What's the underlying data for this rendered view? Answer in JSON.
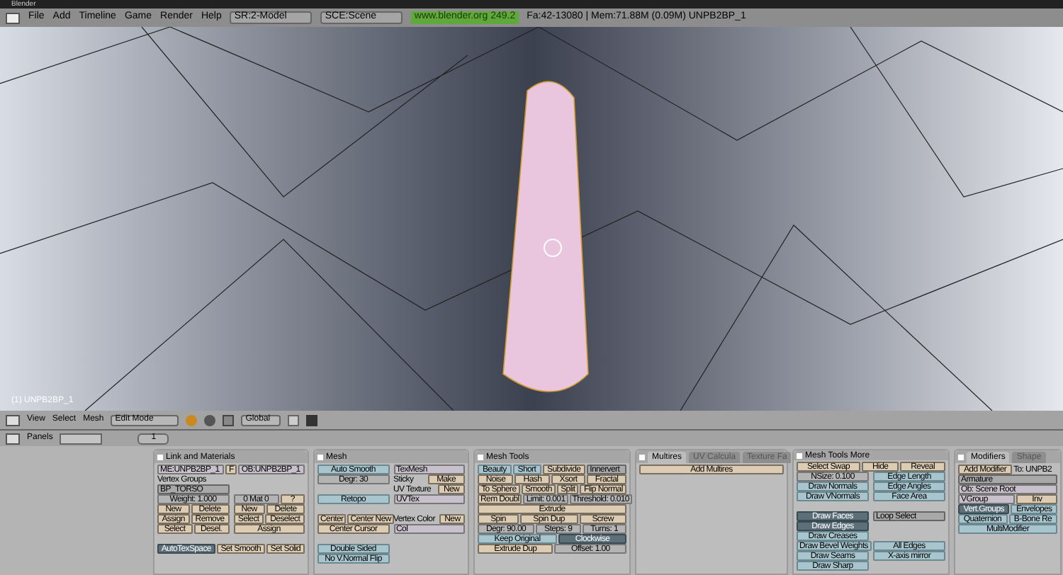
{
  "window": {
    "title": "Blender"
  },
  "menu_bar": {
    "menus": [
      "File",
      "Add",
      "Timeline",
      "Game",
      "Render",
      "Help"
    ],
    "screen": "SR:2-Model",
    "scene": "SCE:Scene",
    "version": "www.blender.org 249.2",
    "stats": "Fa:42-13080 | Mem:71.88M (0.09M) UNPB2BP_1"
  },
  "viewport": {
    "object_label": "(1) UNPB2BP_1"
  },
  "viewport_header": {
    "menus": [
      "View",
      "Select",
      "Mesh"
    ],
    "mode": "Edit Mode",
    "orientation": "Global"
  },
  "buttons_header": {
    "label": "Panels",
    "frame": "1"
  },
  "panels": [
    {
      "title": "Link and Materials",
      "sections": [
        {
          "kind": "rows",
          "rows": [
            [
              {
                "kind": "text",
                "label": "ME:UNPB2BP_1"
              },
              {
                "kind": "button",
                "label": "F"
              },
              {
                "kind": "text",
                "label": "OB:UNPB2BP_1"
              }
            ]
          ]
        },
        {
          "kind": "columns",
          "columns": [
            [
              [
                {
                  "kind": "label",
                  "label": "Vertex Groups"
                }
              ],
              [
                {
                  "kind": "menu",
                  "label": "BP_TORSO"
                }
              ],
              [
                {
                  "kind": "field",
                  "label": "Weight: 1.000"
                }
              ],
              [
                {
                  "kind": "button",
                  "label": "New"
                },
                {
                  "kind": "button",
                  "label": "Delete"
                }
              ],
              [
                {
                  "kind": "button",
                  "label": "Assign"
                },
                {
                  "kind": "button",
                  "label": "Remove"
                }
              ],
              [
                {
                  "kind": "button",
                  "label": "Select"
                },
                {
                  "kind": "button",
                  "label": "Desel."
                }
              ]
            ],
            [
              [
                {
                  "kind": "gap"
                }
              ],
              [
                {
                  "kind": "gap"
                }
              ],
              [
                {
                  "kind": "field",
                  "label": "0 Mat 0"
                },
                {
                  "kind": "button",
                  "label": "?"
                }
              ],
              [
                {
                  "kind": "button",
                  "label": "New"
                },
                {
                  "kind": "button",
                  "label": "Delete"
                }
              ],
              [
                {
                  "kind": "button",
                  "label": "Select"
                },
                {
                  "kind": "button",
                  "label": "Deselect"
                }
              ],
              [
                {
                  "kind": "button",
                  "label": "Assign"
                }
              ]
            ]
          ]
        },
        {
          "kind": "rows",
          "rows": [
            [
              {
                "kind": "gap"
              }
            ],
            [
              {
                "kind": "toggle",
                "label": "AutoTexSpace",
                "selected": true
              },
              {
                "kind": "button",
                "label": "Set Smooth"
              },
              {
                "kind": "button",
                "label": "Set Solid"
              }
            ]
          ]
        }
      ]
    },
    {
      "title": "Mesh",
      "sections": [
        {
          "kind": "columns",
          "columns": [
            [
              [
                {
                  "kind": "toggle",
                  "label": "Auto Smooth",
                  "selected": false
                }
              ],
              [
                {
                  "kind": "field",
                  "label": "Degr: 30"
                }
              ],
              [
                {
                  "kind": "gap"
                }
              ],
              [
                {
                  "kind": "toggle",
                  "label": "Retopo",
                  "selected": false
                }
              ],
              [
                {
                  "kind": "gap"
                }
              ],
              [
                {
                  "kind": "button",
                  "label": "Center"
                },
                {
                  "kind": "button",
                  "label": "Center New"
                }
              ],
              [
                {
                  "kind": "button",
                  "label": "Center Cursor"
                }
              ],
              [
                {
                  "kind": "gap"
                }
              ],
              [
                {
                  "kind": "toggle",
                  "label": "Double Sided",
                  "selected": false
                }
              ],
              [
                {
                  "kind": "toggle",
                  "label": "No V.Normal Flip",
                  "selected": false
                }
              ]
            ],
            [
              [
                {
                  "kind": "text",
                  "label": "TexMesh"
                }
              ],
              [
                {
                  "kind": "label",
                  "label": "Sticky"
                },
                {
                  "kind": "button",
                  "label": "Make"
                }
              ],
              [
                {
                  "kind": "label",
                  "label": "UV Texture"
                },
                {
                  "kind": "button",
                  "label": "New"
                }
              ],
              [
                {
                  "kind": "text",
                  "label": "UVTex"
                }
              ],
              [
                {
                  "kind": "gap"
                }
              ],
              [
                {
                  "kind": "label",
                  "label": "Vertex Color"
                },
                {
                  "kind": "button",
                  "label": "New"
                }
              ],
              [
                {
                  "kind": "text",
                  "label": "Col"
                }
              ]
            ]
          ]
        }
      ]
    },
    {
      "title": "Mesh Tools",
      "sections": [
        {
          "kind": "rows",
          "rows": [
            [
              {
                "kind": "toggle",
                "label": "Beauty",
                "selected": false
              },
              {
                "kind": "toggle",
                "label": "Short",
                "selected": false
              },
              {
                "kind": "button",
                "label": "Subdivide"
              },
              {
                "kind": "menu",
                "label": "Innervert"
              }
            ],
            [
              {
                "kind": "button",
                "label": "Noise"
              },
              {
                "kind": "button",
                "label": "Hash"
              },
              {
                "kind": "button",
                "label": "Xsort"
              },
              {
                "kind": "button",
                "label": "Fractal"
              }
            ],
            [
              {
                "kind": "button",
                "label": "To Sphere"
              },
              {
                "kind": "button",
                "label": "Smooth"
              },
              {
                "kind": "button",
                "label": "Split"
              },
              {
                "kind": "button",
                "label": "Flip Normal"
              }
            ],
            [
              {
                "kind": "button",
                "label": "Rem Doubl"
              },
              {
                "kind": "field",
                "label": "Limit: 0.001"
              },
              {
                "kind": "field",
                "label": "Threshold: 0.010"
              }
            ],
            [
              {
                "kind": "button",
                "label": "Extrude"
              }
            ],
            [
              {
                "kind": "button",
                "label": "Spin"
              },
              {
                "kind": "button",
                "label": "Spin Dup"
              },
              {
                "kind": "button",
                "label": "Screw"
              }
            ],
            [
              {
                "kind": "field",
                "label": "Degr: 90.00"
              },
              {
                "kind": "field",
                "label": "Steps: 9"
              },
              {
                "kind": "field",
                "label": "Turns: 1"
              }
            ],
            [
              {
                "kind": "toggle",
                "label": "Keep Original",
                "selected": false
              },
              {
                "kind": "toggle",
                "label": "Clockwise",
                "selected": true
              }
            ],
            [
              {
                "kind": "button",
                "label": "Extrude Dup"
              },
              {
                "kind": "field",
                "label": "Offset: 1.00"
              }
            ]
          ]
        }
      ]
    },
    {
      "tabs": [
        {
          "label": "Multires",
          "selected": true
        },
        {
          "label": "UV Calcula",
          "selected": false
        },
        {
          "label": "Texture Fa",
          "selected": false
        }
      ],
      "sections": [
        {
          "kind": "rows",
          "rows": [
            [
              {
                "kind": "button",
                "label": "Add Multires"
              }
            ]
          ]
        }
      ]
    },
    {
      "title": "Mesh Tools More",
      "sections": [
        {
          "kind": "rows",
          "rows": [
            [
              {
                "kind": "button",
                "label": "Select Swap"
              },
              {
                "kind": "button",
                "label": "Hide"
              },
              {
                "kind": "button",
                "label": "Reveal"
              }
            ]
          ]
        },
        {
          "kind": "columns",
          "columns": [
            [
              [
                {
                  "kind": "field",
                  "label": "NSize: 0.100"
                }
              ],
              [
                {
                  "kind": "toggle",
                  "label": "Draw Normals",
                  "selected": false
                }
              ],
              [
                {
                  "kind": "toggle",
                  "label": "Draw VNormals",
                  "selected": false
                }
              ],
              [
                {
                  "kind": "gap"
                }
              ],
              [
                {
                  "kind": "toggle",
                  "label": "Draw Faces",
                  "selected": true
                }
              ],
              [
                {
                  "kind": "toggle",
                  "label": "Draw Edges",
                  "selected": true
                }
              ],
              [
                {
                  "kind": "toggle",
                  "label": "Draw Creases",
                  "selected": false
                }
              ],
              [
                {
                  "kind": "toggle",
                  "label": "Draw Bevel Weights",
                  "selected": false
                }
              ],
              [
                {
                  "kind": "toggle",
                  "label": "Draw Seams",
                  "selected": false
                }
              ],
              [
                {
                  "kind": "toggle",
                  "label": "Draw Sharp",
                  "selected": false
                }
              ]
            ],
            [
              [
                {
                  "kind": "toggle",
                  "label": "Edge Length",
                  "selected": false
                }
              ],
              [
                {
                  "kind": "toggle",
                  "label": "Edge Angles",
                  "selected": false
                }
              ],
              [
                {
                  "kind": "toggle",
                  "label": "Face Area",
                  "selected": false
                }
              ],
              [
                {
                  "kind": "gap"
                }
              ],
              [
                {
                  "kind": "menu",
                  "label": "Loop Select"
                }
              ],
              [
                {
                  "kind": "gap"
                }
              ],
              [
                {
                  "kind": "gap"
                }
              ],
              [
                {
                  "kind": "toggle",
                  "label": "All Edges",
                  "selected": false
                }
              ],
              [
                {
                  "kind": "toggle",
                  "label": "X-axis mirror",
                  "selected": false
                }
              ]
            ]
          ]
        }
      ]
    },
    {
      "tabs": [
        {
          "label": "Modifiers",
          "selected": true
        },
        {
          "label": "Shape",
          "selected": false
        }
      ],
      "sections": [
        {
          "kind": "rows",
          "rows": [
            [
              {
                "kind": "button",
                "label": "Add Modifier"
              },
              {
                "kind": "label",
                "label": "To: UNPB2"
              }
            ],
            [
              {
                "kind": "menu",
                "label": "Armature"
              }
            ],
            [
              {
                "kind": "text",
                "label": "Ob: Scene Root"
              }
            ],
            [
              {
                "kind": "text",
                "label": "VGroup"
              },
              {
                "kind": "button",
                "label": "Inv"
              }
            ],
            [
              {
                "kind": "toggle",
                "label": "Vert.Groups",
                "selected": true
              },
              {
                "kind": "toggle",
                "label": "Envelopes",
                "selected": false
              }
            ],
            [
              {
                "kind": "toggle",
                "label": "Quaternion",
                "selected": false
              },
              {
                "kind": "toggle",
                "label": "B-Bone Re",
                "selected": false
              }
            ],
            [
              {
                "kind": "toggle",
                "label": "MultiModifier",
                "selected": false
              }
            ]
          ]
        }
      ]
    }
  ]
}
